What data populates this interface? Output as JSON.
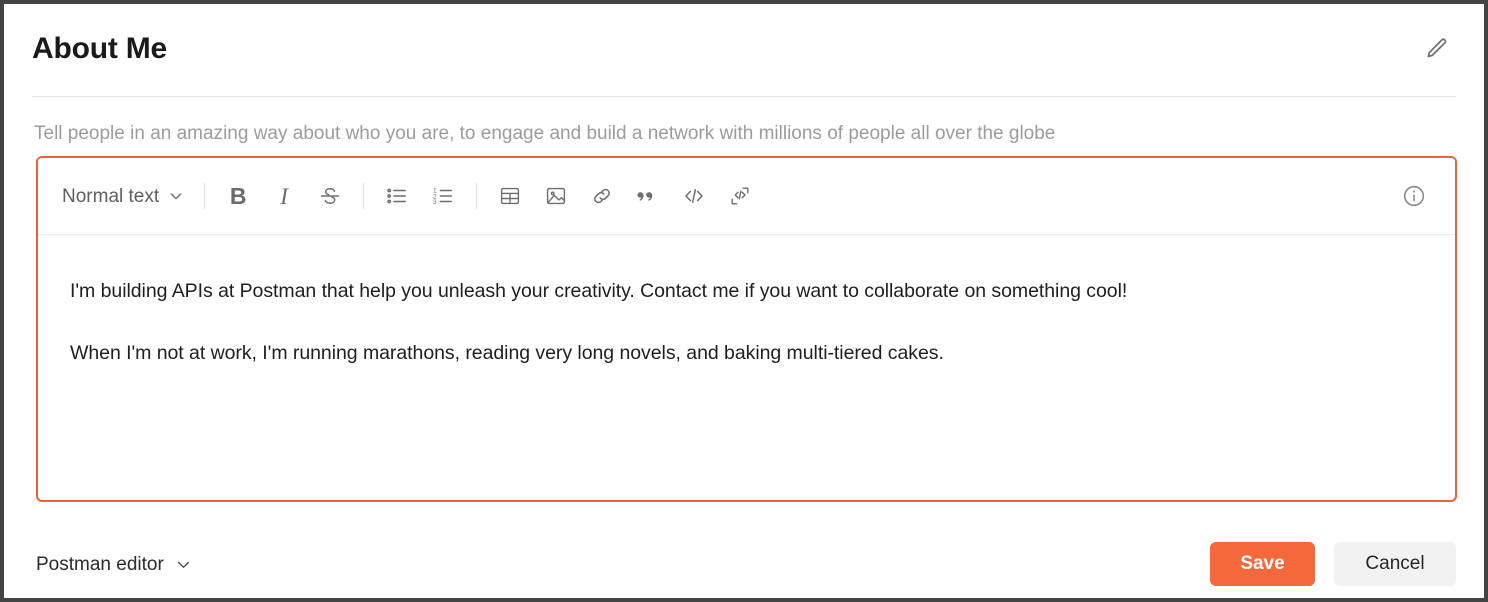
{
  "header": {
    "title": "About Me",
    "edit_icon": "pencil-icon"
  },
  "subtitle": "Tell people in an amazing way about who you are, to engage and build a network with millions of people all over the globe",
  "editor": {
    "border_color": "#e8633a",
    "toolbar": {
      "style_dropdown": {
        "selected": "Normal text",
        "chevron_icon": "chevron-down-icon"
      },
      "buttons": [
        {
          "name": "bold-button",
          "label": "B",
          "icon": "bold-icon"
        },
        {
          "name": "italic-button",
          "label": "I",
          "icon": "italic-icon"
        },
        {
          "name": "strikethrough-button",
          "label": "S",
          "icon": "strikethrough-icon"
        },
        {
          "name": "bullet-list-button",
          "icon": "bullet-list-icon"
        },
        {
          "name": "numbered-list-button",
          "icon": "numbered-list-icon"
        },
        {
          "name": "table-button",
          "icon": "table-icon"
        },
        {
          "name": "image-button",
          "icon": "image-icon"
        },
        {
          "name": "link-button",
          "icon": "link-icon"
        },
        {
          "name": "blockquote-button",
          "icon": "quote-icon"
        },
        {
          "name": "inline-code-button",
          "icon": "code-icon"
        },
        {
          "name": "code-block-button",
          "icon": "code-block-icon"
        }
      ],
      "info_icon": "info-icon"
    },
    "content": {
      "paragraphs": [
        "I'm building APIs at Postman that help you unleash your creativity. Contact me if you want to collaborate on something cool!",
        "When I'm not at work, I'm running marathons, reading very long novels, and baking multi-tiered cakes."
      ]
    }
  },
  "footer": {
    "editor_picker": {
      "label": "Postman editor",
      "chevron_icon": "chevron-down-icon"
    },
    "save_label": "Save",
    "cancel_label": "Cancel",
    "save_color": "#f4683c"
  }
}
